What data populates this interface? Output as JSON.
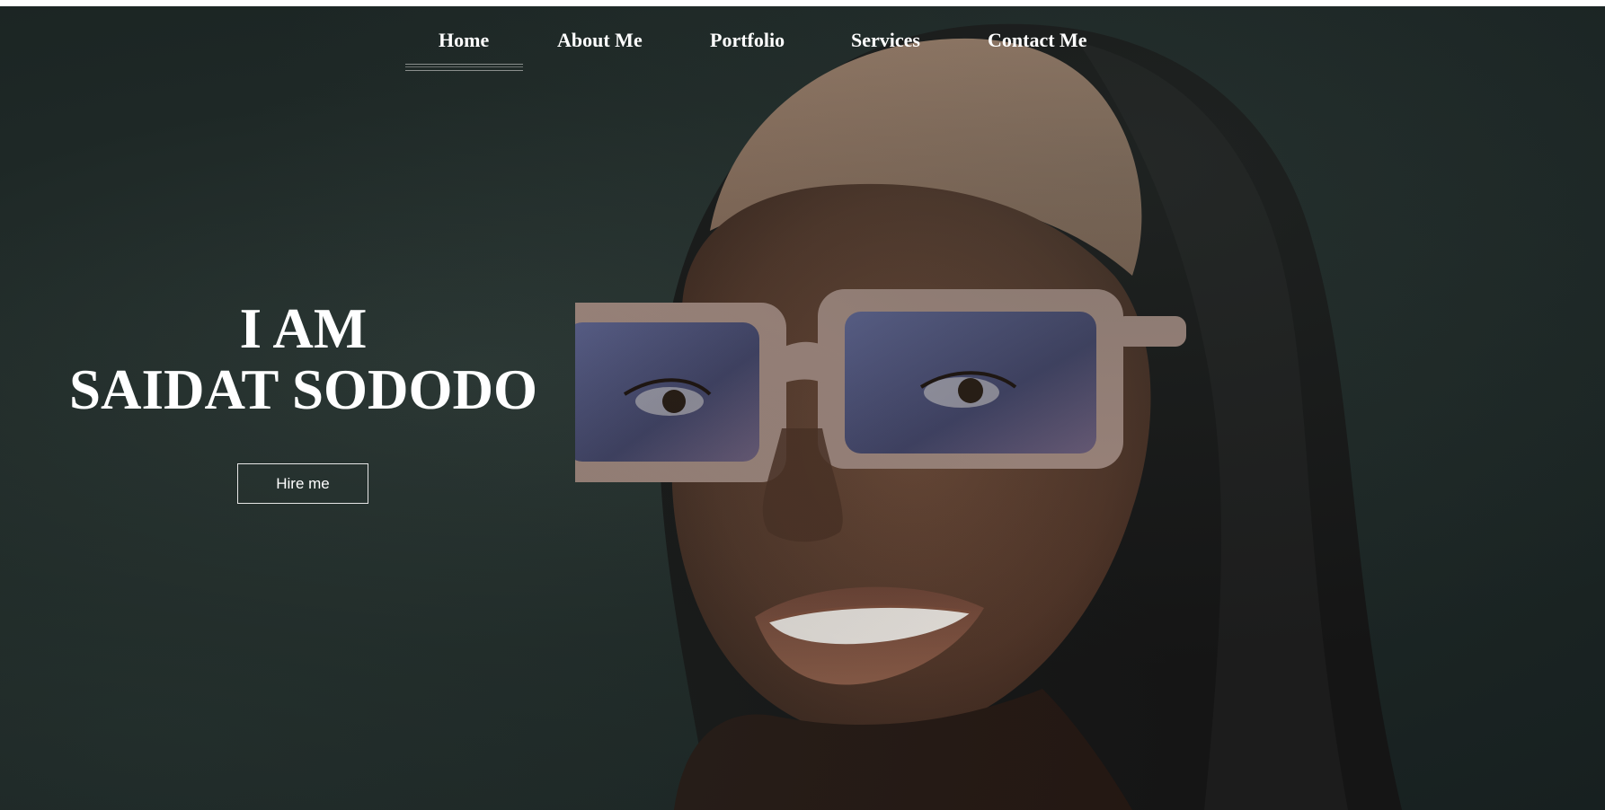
{
  "nav": {
    "items": [
      {
        "label": "Home",
        "active": true
      },
      {
        "label": "About Me"
      },
      {
        "label": "Portfolio"
      },
      {
        "label": "Services"
      },
      {
        "label": "Contact Me"
      }
    ]
  },
  "hero": {
    "line1": "I AM",
    "line2": "SAIDAT SODODO",
    "button_label": "Hire me",
    "image": "portrait-photo"
  },
  "colors": {
    "background": "#1e2826",
    "text": "#ffffff"
  }
}
